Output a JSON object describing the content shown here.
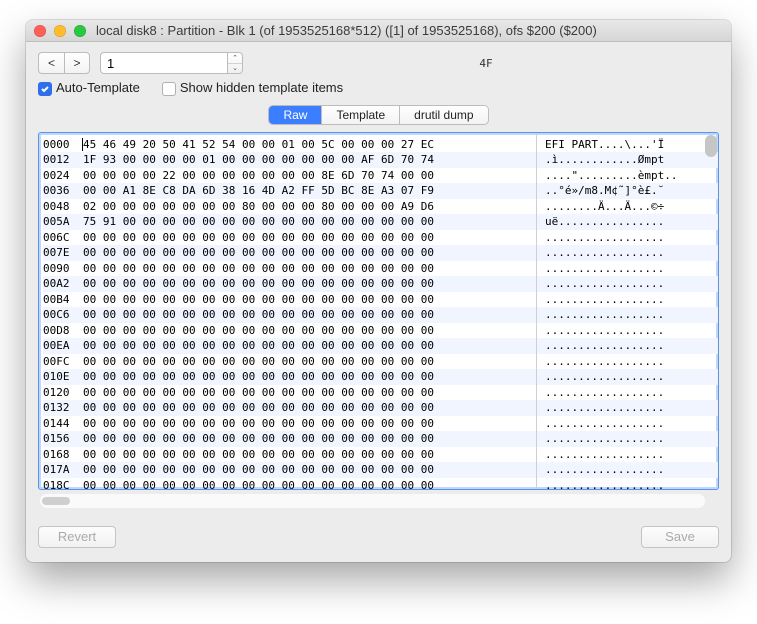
{
  "window": {
    "title": "local disk8 : Partition - Blk 1 (of 1953525168*512) ([1] of 1953525168), ofs $200 ($200)"
  },
  "nav": {
    "prev": "<",
    "next": ">"
  },
  "block_input": {
    "value": "1"
  },
  "offset_display": "4F",
  "checkbox_auto": {
    "label": "Auto-Template",
    "checked": true
  },
  "checkbox_hidden": {
    "label": "Show hidden template items",
    "checked": false
  },
  "tabs": {
    "raw": "Raw",
    "template": "Template",
    "drutil": "drutil dump",
    "active": "raw"
  },
  "hex": {
    "rows": [
      {
        "off": "0000",
        "b": "45 46 49 20 50 41 52 54 00 00 01 00 5C 00 00 00 27 EC",
        "a": "EFI PART....\\...'Ï"
      },
      {
        "off": "0012",
        "b": "1F 93 00 00 00 00 01 00 00 00 00 00 00 00 AF 6D 70 74",
        "a": ".ì............Ømpt"
      },
      {
        "off": "0024",
        "b": "00 00 00 00 22 00 00 00 00 00 00 00 8E 6D 70 74 00 00",
        "a": "....\".........èmpt.."
      },
      {
        "off": "0036",
        "b": "00 00 A1 8E C8 DA 6D 38 16 4D A2 FF 5D BC 8E A3 07 F9",
        "a": "..°é»/m8.M¢˜]°è£.˘"
      },
      {
        "off": "0048",
        "b": "02 00 00 00 00 00 00 00 80 00 00 00 80 00 00 00 A9 D6",
        "a": "........Ä...Ä...©÷"
      },
      {
        "off": "005A",
        "b": "75 91 00 00 00 00 00 00 00 00 00 00 00 00 00 00 00 00",
        "a": "uë................"
      },
      {
        "off": "006C",
        "b": "00 00 00 00 00 00 00 00 00 00 00 00 00 00 00 00 00 00",
        "a": ".................."
      },
      {
        "off": "007E",
        "b": "00 00 00 00 00 00 00 00 00 00 00 00 00 00 00 00 00 00",
        "a": ".................."
      },
      {
        "off": "0090",
        "b": "00 00 00 00 00 00 00 00 00 00 00 00 00 00 00 00 00 00",
        "a": ".................."
      },
      {
        "off": "00A2",
        "b": "00 00 00 00 00 00 00 00 00 00 00 00 00 00 00 00 00 00",
        "a": ".................."
      },
      {
        "off": "00B4",
        "b": "00 00 00 00 00 00 00 00 00 00 00 00 00 00 00 00 00 00",
        "a": ".................."
      },
      {
        "off": "00C6",
        "b": "00 00 00 00 00 00 00 00 00 00 00 00 00 00 00 00 00 00",
        "a": ".................."
      },
      {
        "off": "00D8",
        "b": "00 00 00 00 00 00 00 00 00 00 00 00 00 00 00 00 00 00",
        "a": ".................."
      },
      {
        "off": "00EA",
        "b": "00 00 00 00 00 00 00 00 00 00 00 00 00 00 00 00 00 00",
        "a": ".................."
      },
      {
        "off": "00FC",
        "b": "00 00 00 00 00 00 00 00 00 00 00 00 00 00 00 00 00 00",
        "a": ".................."
      },
      {
        "off": "010E",
        "b": "00 00 00 00 00 00 00 00 00 00 00 00 00 00 00 00 00 00",
        "a": ".................."
      },
      {
        "off": "0120",
        "b": "00 00 00 00 00 00 00 00 00 00 00 00 00 00 00 00 00 00",
        "a": ".................."
      },
      {
        "off": "0132",
        "b": "00 00 00 00 00 00 00 00 00 00 00 00 00 00 00 00 00 00",
        "a": ".................."
      },
      {
        "off": "0144",
        "b": "00 00 00 00 00 00 00 00 00 00 00 00 00 00 00 00 00 00",
        "a": ".................."
      },
      {
        "off": "0156",
        "b": "00 00 00 00 00 00 00 00 00 00 00 00 00 00 00 00 00 00",
        "a": ".................."
      },
      {
        "off": "0168",
        "b": "00 00 00 00 00 00 00 00 00 00 00 00 00 00 00 00 00 00",
        "a": ".................."
      },
      {
        "off": "017A",
        "b": "00 00 00 00 00 00 00 00 00 00 00 00 00 00 00 00 00 00",
        "a": ".................."
      },
      {
        "off": "018C",
        "b": "00 00 00 00 00 00 00 00 00 00 00 00 00 00 00 00 00 00",
        "a": ".................."
      }
    ]
  },
  "footer": {
    "revert": "Revert",
    "save": "Save"
  }
}
